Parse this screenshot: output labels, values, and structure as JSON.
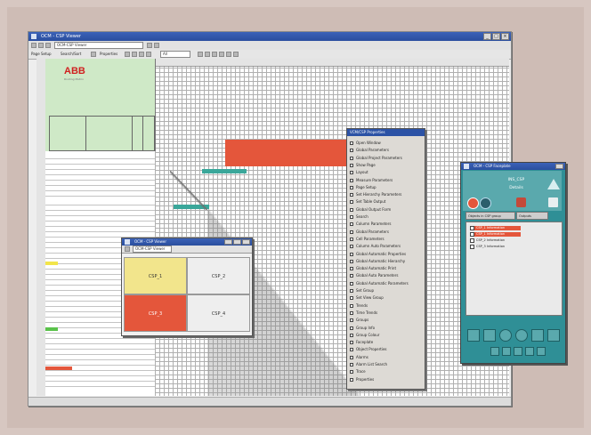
{
  "main_window": {
    "title": "OCM - CSP Viewer",
    "toolbar": {
      "path_combo": "OCM-CSP Viewer",
      "menu_items": [
        "Page Setup",
        "Search/Sort",
        "Properties"
      ],
      "view_combo": "All"
    },
    "logo": {
      "brand": "ABB",
      "tagline": "Routing Matrix"
    },
    "status": ""
  },
  "context_menu": {
    "title": "VCM/CSP Properties",
    "items": [
      {
        "label": "Open Window"
      },
      {
        "label": "Global Parameters"
      },
      {
        "label": "Global Project Parameters"
      },
      {
        "label": "Show Page"
      },
      {
        "label": "Layout"
      },
      {
        "label": "Measure Parameters"
      },
      {
        "label": "Page Setup"
      },
      {
        "label": "Set Hierarchy Parameters"
      },
      {
        "label": "Set Table Output"
      },
      {
        "label": "Global Output Form"
      },
      {
        "label": "Search"
      },
      {
        "label": "Column Parameters"
      },
      {
        "label": "Global Parameters"
      },
      {
        "label": "Cell Parameters"
      },
      {
        "label": "Column Auto Parameters"
      },
      {
        "label": "Global Automatic Properties"
      },
      {
        "label": "Global Automatic Hierarchy"
      },
      {
        "label": "Global Automatic Print"
      },
      {
        "label": "Global Auto Parameters"
      },
      {
        "label": "Global Automatic Parameters"
      },
      {
        "label": "Set Group"
      },
      {
        "label": "Set View Group"
      },
      {
        "label": "Trends"
      },
      {
        "label": "Time Trends"
      },
      {
        "label": "Groups"
      },
      {
        "label": "Group Info"
      },
      {
        "label": "Group Colour"
      },
      {
        "label": "Faceplate"
      },
      {
        "label": "Object Properties"
      },
      {
        "label": "Alarms"
      },
      {
        "label": "Alarm List Search"
      },
      {
        "label": "Trace"
      },
      {
        "label": "Properties"
      }
    ]
  },
  "group_window": {
    "title": "OCM - CSP Viewer",
    "subtitle": "OCM-CSP Viewer",
    "cells": [
      {
        "label": "CSP_1",
        "color": "#f2e58c"
      },
      {
        "label": "CSP_2",
        "color": "#eeeeee"
      },
      {
        "label": "CSP_3",
        "color": "#e4563b"
      },
      {
        "label": "CSP_4",
        "color": "#eeeeee"
      }
    ]
  },
  "faceplate_window": {
    "title": "OCM - CSP Faceplate",
    "name": "INS_CSP",
    "subtitle": "Details",
    "tabs": [
      "Objects in CSP group",
      "Outputs"
    ],
    "list_items": [
      {
        "label": "CSP_1 Information",
        "highlight": true
      },
      {
        "label": "CSP_1 Information",
        "highlight": true
      },
      {
        "label": "CSP_2 Information",
        "highlight": false
      },
      {
        "label": "CSP_3 Information",
        "highlight": false
      }
    ]
  },
  "colors": {
    "alarm_red": "#e4563b",
    "teal": "#3aa79a",
    "header_green": "#cfe9c7",
    "title_blue": "#2a4e9e",
    "faceplate_teal": "#2f8f96"
  }
}
